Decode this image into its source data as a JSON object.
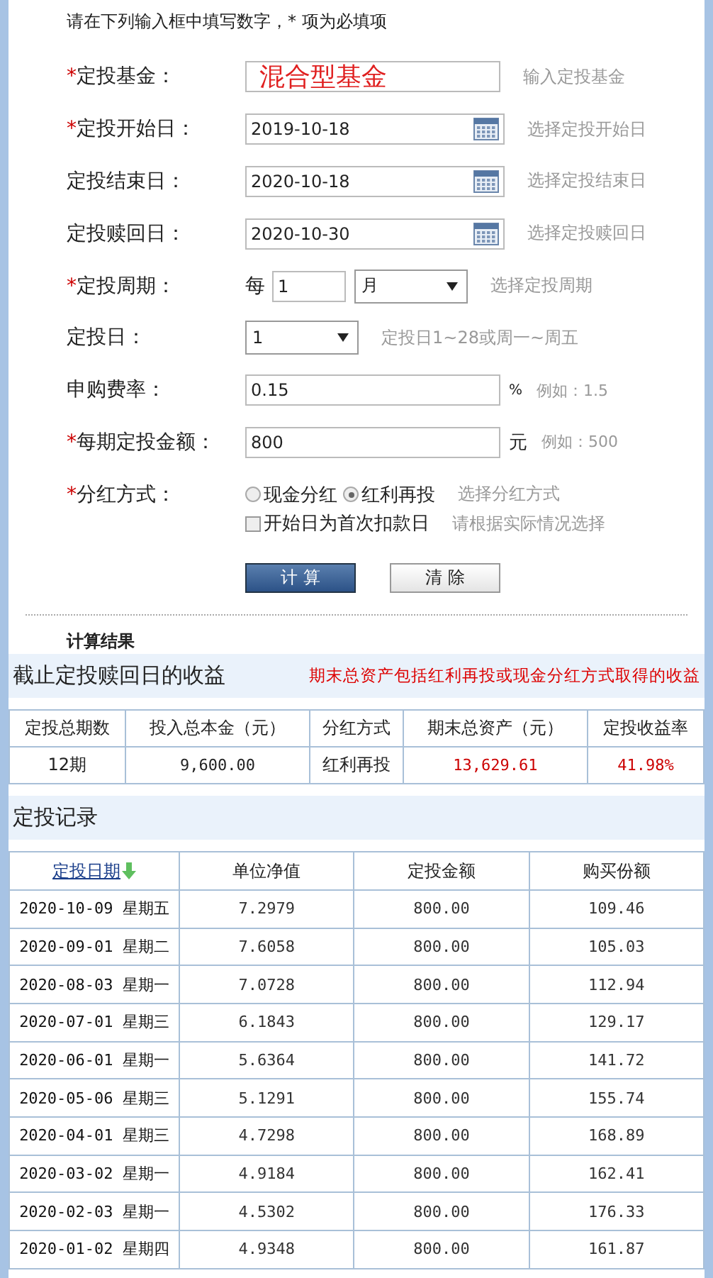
{
  "form": {
    "instruction": "请在下列输入框中填写数字，* 项为必填项",
    "fields": [
      {
        "kind": "text",
        "marker": "*",
        "label": "定投基金：",
        "value": "混合型基金",
        "hint": "输入定投基金"
      },
      {
        "kind": "date",
        "marker": "*",
        "label": "定投开始日：",
        "value": "2019-10-18",
        "hint": "选择定投开始日"
      },
      {
        "kind": "date",
        "label": "定投结束日：",
        "value": "2020-10-18",
        "hint": "选择定投结束日"
      },
      {
        "kind": "date",
        "label": "定投赎回日：",
        "value": "2020-10-30",
        "hint": "选择定投赎回日"
      },
      {
        "kind": "period",
        "marker": "*",
        "label": "定投周期：",
        "prefix": "每",
        "value": "1",
        "select": "月",
        "hint": "选择定投周期"
      },
      {
        "kind": "select",
        "label": "定投日：",
        "value": "1",
        "hint": "定投日1~28或周一~周五"
      },
      {
        "kind": "unit",
        "label": "申购费率：",
        "value": "0.15",
        "unit": "%",
        "hint": "例如：1.5"
      },
      {
        "kind": "unit",
        "marker": "*",
        "label": "每期定投金额：",
        "value": "800",
        "unit": "元",
        "hint": "例如：500"
      },
      {
        "kind": "radio",
        "marker": "*",
        "label": "分红方式：",
        "options": [
          {
            "label": "现金分红",
            "selected": false
          },
          {
            "label": "红利再投",
            "selected": true
          }
        ],
        "hint": "选择分红方式"
      },
      {
        "kind": "checkbox",
        "option": "开始日为首次扣款日",
        "checked": false,
        "hint": "请根据实际情况选择"
      }
    ],
    "buttons": [
      {
        "label": "计 算",
        "kind": "primary"
      },
      {
        "label": "清 除",
        "kind": "secondary"
      }
    ]
  },
  "results": {
    "heading": "计算结果",
    "title": "截止定投赎回日的收益",
    "note": "期末总资产包括红利再投或现金分红方式取得的收益",
    "columns": [
      "定投总期数",
      "投入总本金（元）",
      "分红方式",
      "期末总资产（元）",
      "定投收益率"
    ],
    "row": [
      {
        "text": "12期",
        "highlight": false
      },
      {
        "text": "9,600.00",
        "highlight": false
      },
      {
        "text": "红利再投",
        "highlight": false
      },
      {
        "text": "13,629.61",
        "highlight": true
      },
      {
        "text": "41.98%",
        "highlight": true
      }
    ]
  },
  "records": {
    "title": "定投记录",
    "columns": [
      {
        "label": "定投日期",
        "sorted": true
      },
      {
        "label": "单位净值",
        "sorted": false
      },
      {
        "label": "定投金额",
        "sorted": false
      },
      {
        "label": "购买份额",
        "sorted": false
      }
    ],
    "rows": [
      [
        "2020-10-09 星期五",
        "7.2979",
        "800.00",
        "109.46"
      ],
      [
        "2020-09-01 星期二",
        "7.6058",
        "800.00",
        "105.03"
      ],
      [
        "2020-08-03 星期一",
        "7.0728",
        "800.00",
        "112.94"
      ],
      [
        "2020-07-01 星期三",
        "6.1843",
        "800.00",
        "129.17"
      ],
      [
        "2020-06-01 星期一",
        "5.6364",
        "800.00",
        "141.72"
      ],
      [
        "2020-05-06 星期三",
        "5.1291",
        "800.00",
        "155.74"
      ],
      [
        "2020-04-01 星期三",
        "4.7298",
        "800.00",
        "168.89"
      ],
      [
        "2020-03-02 星期一",
        "4.9184",
        "800.00",
        "162.41"
      ],
      [
        "2020-02-03 星期一",
        "4.5302",
        "800.00",
        "176.33"
      ],
      [
        "2020-01-02 星期四",
        "4.9348",
        "800.00",
        "161.87"
      ]
    ]
  }
}
